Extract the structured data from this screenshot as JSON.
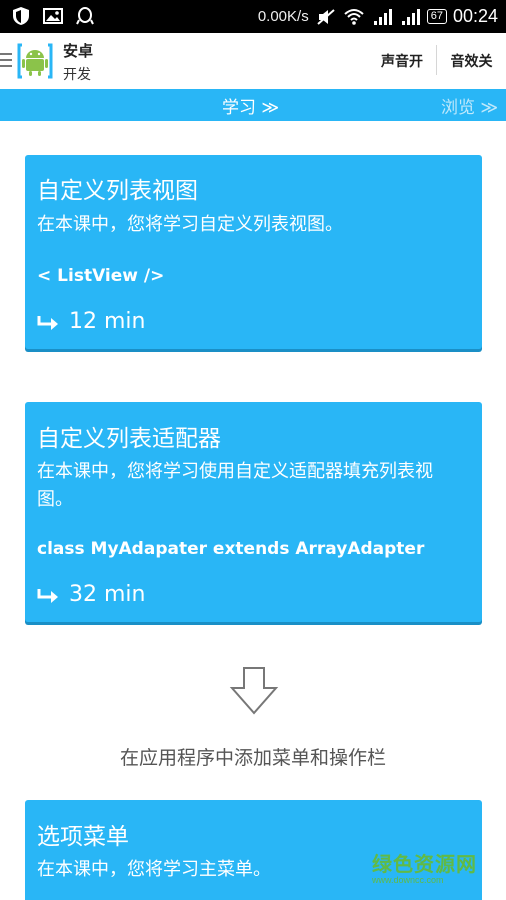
{
  "status_bar": {
    "net_speed": "0.00K/s",
    "battery": "67",
    "time": "00:24"
  },
  "action_bar": {
    "app_title": "安卓",
    "app_subtitle": "开发",
    "sound_button": "声音开",
    "effects_button": "音效关"
  },
  "tabs": {
    "learn": "学习 ≫",
    "browse": "浏览 ≫"
  },
  "cards": [
    {
      "title": "自定义列表视图",
      "description": "在本课中，您将学习自定义列表视图。",
      "code": "< ListView />",
      "duration": "12 min"
    },
    {
      "title": "自定义列表适配器",
      "description": "在本课中，您将学习使用自定义适配器填充列表视图。",
      "code": "class MyAdapater extends ArrayAdapter",
      "duration": "32 min"
    },
    {
      "title": "选项菜单",
      "description": "在本课中，您将学习主菜单。"
    }
  ],
  "section": {
    "title": "在应用程序中添加菜单和操作栏"
  },
  "watermark": {
    "text": "绿色资源网",
    "url": "www.downcc.com"
  },
  "colors": {
    "accent": "#29b6f6",
    "card_shadow": "#1a8fc6",
    "watermark": "#66bb33"
  }
}
